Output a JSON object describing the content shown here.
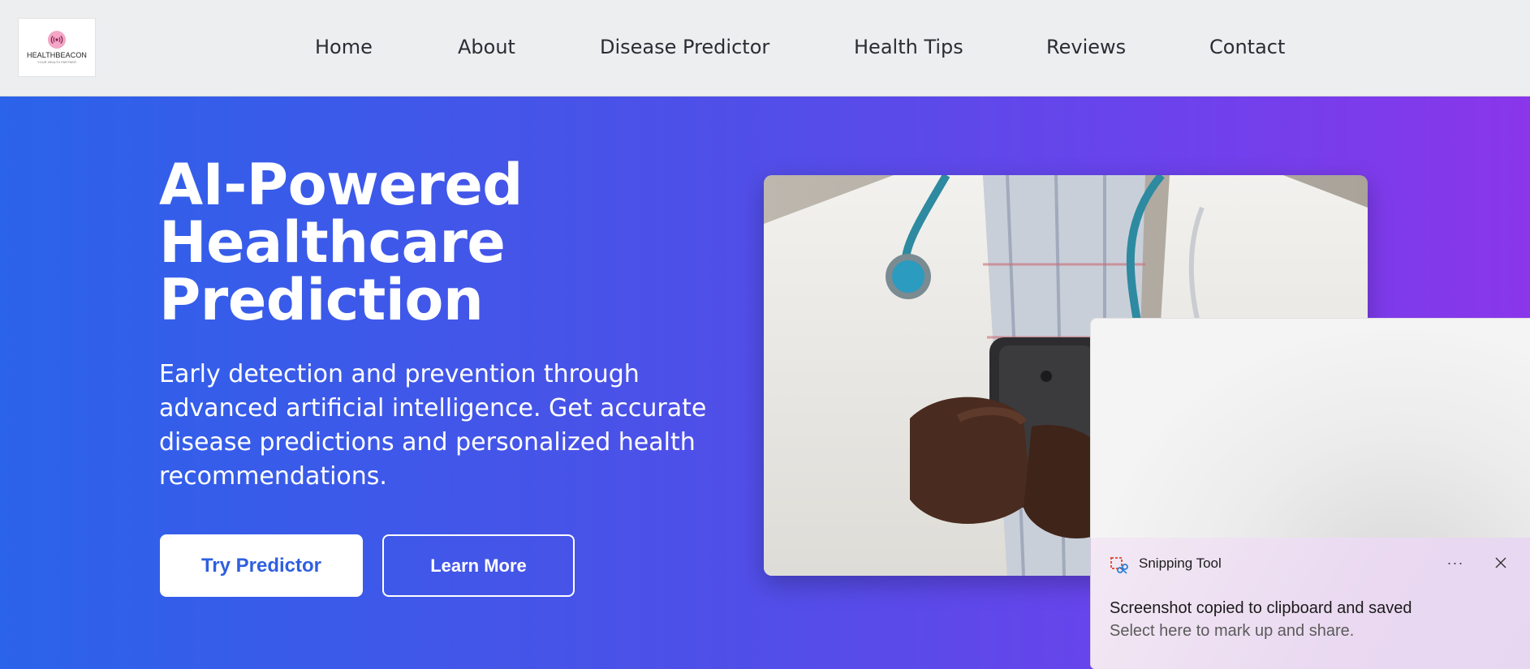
{
  "brand": {
    "name": "HEALTHBEACON",
    "tagline": "YOUR HEALTH PARTNER",
    "accent": "#f3a6c6"
  },
  "nav": {
    "links": [
      "Home",
      "About",
      "Disease Predictor",
      "Health Tips",
      "Reviews",
      "Contact"
    ]
  },
  "hero": {
    "title_lines": [
      "AI-Powered",
      "Healthcare",
      "Prediction"
    ],
    "subtitle": "Early detection and prevention through advanced artificial intelligence. Get accurate disease predictions and personalized health recommendations.",
    "primary_button": "Try Predictor",
    "secondary_button": "Learn More",
    "gradient_start": "#2b63ea",
    "gradient_end": "#8a36ea",
    "image_alt": "doctor-with-stethoscope-using-phone"
  },
  "snipping_tool": {
    "app_name": "Snipping Tool",
    "more_label": "···",
    "title": "Screenshot copied to clipboard and saved",
    "body": "Select here to mark up and share."
  }
}
